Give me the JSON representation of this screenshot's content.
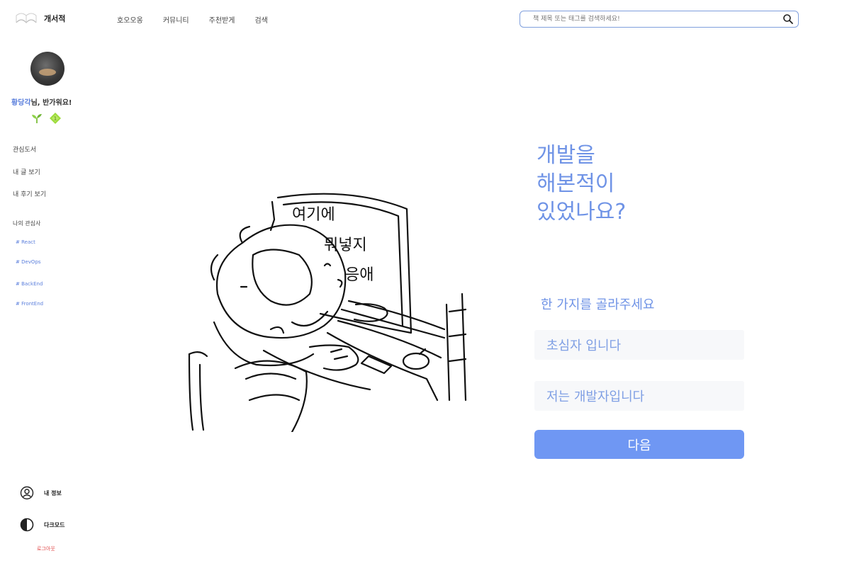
{
  "header": {
    "logo_text": "개서적",
    "nav": [
      "호오오옹",
      "커뮤니티",
      "주천받게",
      "검색"
    ],
    "search": {
      "placeholder": "책 제목 또는 태그를 검색하세요!"
    }
  },
  "sidebar": {
    "greeting_name": "황당각",
    "greeting_suffix": "님, 반가워요!",
    "menu": [
      "관심도서",
      "내 글 보기",
      "내 후기 보기"
    ],
    "interest_title": "나의 관심사",
    "tags": [
      "# React",
      "# DevOps",
      "# BackEnd",
      "# FrontEnd"
    ],
    "bottom": {
      "profile_label": "내 정보",
      "theme_label": "다크모드",
      "logout_label": "로그아웃"
    }
  },
  "illustration": {
    "handwriting": [
      "여기에",
      "뭐넣지",
      "응애"
    ]
  },
  "main": {
    "headline": [
      "개발을",
      "해본적이",
      "있었나요?"
    ],
    "choose_label": "한 가지를 골라주세요",
    "options": [
      "초심자 입니다",
      "저는 개발자입니다"
    ],
    "next_label": "다음"
  },
  "colors": {
    "accent": "#6f93e6",
    "button": "#6f97f3",
    "logout": "#e04b4b",
    "tag": "#5b7fdc"
  }
}
